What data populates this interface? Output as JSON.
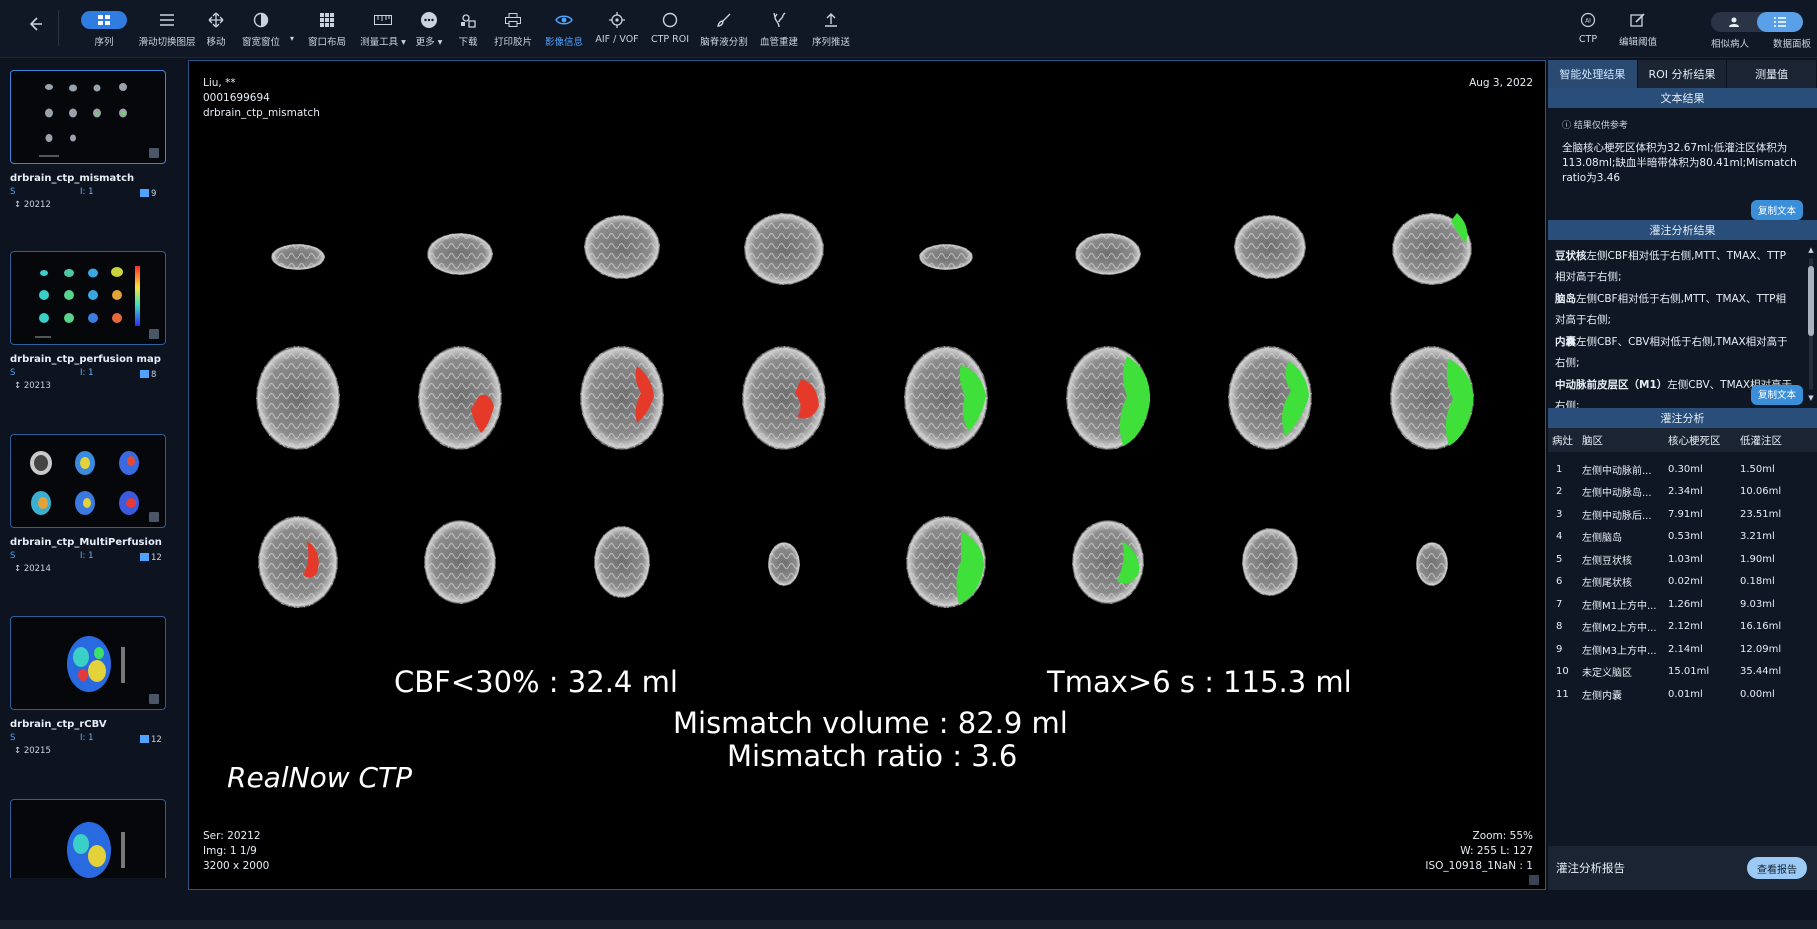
{
  "toolbar": {
    "tools": [
      {
        "label": "序列",
        "icon": "grid-pill-icon",
        "active": false
      },
      {
        "label": "滑动切换图层",
        "icon": "layers-icon"
      },
      {
        "label": "移动",
        "icon": "move-icon"
      },
      {
        "label": "窗宽窗位",
        "icon": "contrast-icon"
      },
      {
        "label": "窗口布局",
        "icon": "layout-grid-icon"
      },
      {
        "label": "测量工具",
        "icon": "ruler-icon"
      },
      {
        "label": "更多",
        "icon": "more-icon"
      },
      {
        "label": "下载",
        "icon": "download-icon"
      },
      {
        "label": "打印胶片",
        "icon": "print-icon"
      },
      {
        "label": "影像信息",
        "icon": "eye-icon",
        "active": true
      },
      {
        "label": "AIF / VOF",
        "icon": "target-icon"
      },
      {
        "label": "CTP ROI",
        "icon": "circle-icon"
      },
      {
        "label": "脑脊液分割",
        "icon": "brush-icon"
      },
      {
        "label": "血管重建",
        "icon": "vessel-icon"
      },
      {
        "label": "序列推送",
        "icon": "upload-icon"
      }
    ],
    "right_tools": [
      {
        "label": "CTP",
        "icon": "ai-icon"
      },
      {
        "label": "编辑阈值",
        "icon": "edit-icon"
      }
    ],
    "segment_labels": [
      "相似病人",
      "数据面板"
    ]
  },
  "series": [
    {
      "name": "drbrain_ctp_mismatch",
      "s": "S",
      "i": "1",
      "count": "9",
      "id": "20212"
    },
    {
      "name": "drbrain_ctp_perfusion map",
      "s": "S",
      "i": "1",
      "count": "8",
      "id": "20213"
    },
    {
      "name": "drbrain_ctp_MultiPerfusion",
      "s": "S",
      "i": "1",
      "count": "12",
      "id": "20214"
    },
    {
      "name": "drbrain_ctp_rCBV",
      "s": "S",
      "i": "1",
      "count": "12",
      "id": "20215"
    },
    {
      "name": "",
      "s": "",
      "i": "",
      "count": "",
      "id": ""
    }
  ],
  "viewer": {
    "patient_name": "Liu, **",
    "patient_id": "0001699694",
    "series_desc": "drbrain_ctp_mismatch",
    "date": "Aug 3, 2022",
    "ser": "Ser: 20212",
    "img": "Img: 1 1/9",
    "dims": "3200 x 2000",
    "zoom": "Zoom: 55%",
    "wl": "W: 255 L: 127",
    "iso": "ISO_10918_1NaN : 1",
    "cbf_text": "CBF<30% : 32.4 ml",
    "tmax_text": "Tmax>6 s : 115.3 ml",
    "mismatch_volume_text": "Mismatch volume : 82.9 ml",
    "mismatch_ratio_text": "Mismatch ratio : 3.6",
    "brand": "RealNow CTP"
  },
  "right_panel": {
    "tabs": [
      "智能处理结果",
      "ROI 分析结果",
      "测量值"
    ],
    "text_result_header": "文本结果",
    "note": "结果仅供参考",
    "text_result_body": "全脑核心梗死区体积为32.67ml;低灌注区体积为113.08ml;缺血半暗带体积为80.41ml;Mismatch ratio为3.46",
    "copy_label": "复制文本",
    "perf_result_header": "灌注分析结果",
    "perf_items": [
      {
        "region": "豆状核",
        "text": "左侧CBF相对低于右侧,MTT、TMAX、TTP相对高于右侧;"
      },
      {
        "region": "脑岛",
        "text": "左侧CBF相对低于右侧,MTT、TMAX、TTP相对高于右侧;"
      },
      {
        "region": "内囊",
        "text": "左侧CBF、CBV相对低于右侧,TMAX相对高于右侧;"
      },
      {
        "region": "中动脉前皮层区（M1）",
        "text": "左侧CBV、TMAX相对高于右侧;"
      }
    ],
    "perf_analysis_header": "灌注分析",
    "table_headers": [
      "病灶",
      "脑区",
      "核心梗死区",
      "低灌注区"
    ],
    "table_rows": [
      [
        "1",
        "左侧中动脉前...",
        "0.30ml",
        "1.50ml"
      ],
      [
        "2",
        "左侧中动脉岛...",
        "2.34ml",
        "10.06ml"
      ],
      [
        "3",
        "左侧中动脉后...",
        "7.91ml",
        "23.51ml"
      ],
      [
        "4",
        "左侧脑岛",
        "0.53ml",
        "3.21ml"
      ],
      [
        "5",
        "左侧豆状核",
        "1.03ml",
        "1.90ml"
      ],
      [
        "6",
        "左侧尾状核",
        "0.02ml",
        "0.18ml"
      ],
      [
        "7",
        "左侧M1上方中...",
        "1.26ml",
        "9.03ml"
      ],
      [
        "8",
        "左侧M2上方中...",
        "2.12ml",
        "16.16ml"
      ],
      [
        "9",
        "左侧M3上方中...",
        "2.14ml",
        "12.09ml"
      ],
      [
        "10",
        "未定义脑区",
        "15.01ml",
        "35.44ml"
      ],
      [
        "11",
        "左侧内囊",
        "0.01ml",
        "0.00ml"
      ]
    ],
    "report_label": "灌注分析报告",
    "report_button": "查看报告"
  },
  "colors": {
    "accent": "#2f7de1",
    "core": "#e53a2a",
    "penumbra": "#3fe03a"
  }
}
